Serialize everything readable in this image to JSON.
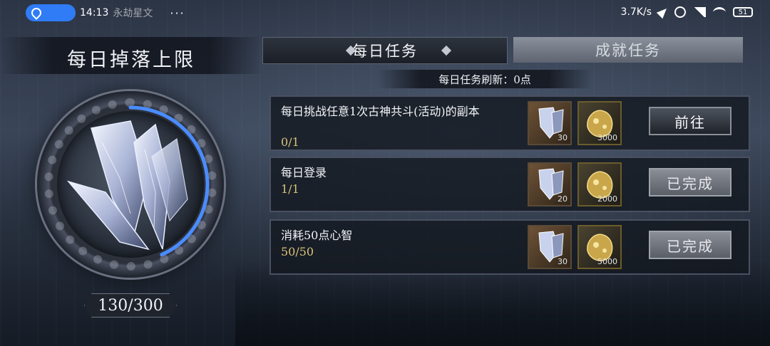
{
  "status_bar": {
    "time": "14:13",
    "app_ghost_text": "永劫星文",
    "dots": "···",
    "net_speed": "3.7K/s",
    "battery": "51"
  },
  "left_panel": {
    "title": "每日掉落上限",
    "counter": "130/300",
    "progress": {
      "current": 130,
      "max": 300
    }
  },
  "tabs": [
    {
      "label": "每日任务",
      "active": true
    },
    {
      "label": "成就任务",
      "active": false
    }
  ],
  "refresh_text": "每日任务刷新：0点",
  "tasks": [
    {
      "title": "每日挑战任意1次古神共斗(活动)的副本",
      "progress": "0/1",
      "rewards": [
        {
          "icon": "crystal-shard-icon",
          "count": "30"
        },
        {
          "icon": "gold-ore-icon",
          "count": "3000"
        }
      ],
      "button": "前往",
      "done": false
    },
    {
      "title": "每日登录",
      "progress": "1/1",
      "rewards": [
        {
          "icon": "crystal-shard-icon",
          "count": "20"
        },
        {
          "icon": "gold-ore-icon",
          "count": "2000"
        }
      ],
      "button": "已完成",
      "done": true
    },
    {
      "title": "消耗50点心智",
      "progress": "50/50",
      "rewards": [
        {
          "icon": "crystal-shard-icon",
          "count": "30"
        },
        {
          "icon": "gold-ore-icon",
          "count": "5000"
        }
      ],
      "button": "已完成",
      "done": true
    }
  ],
  "colors": {
    "progress_ring": "#4a8cff",
    "progress_text": "#d8c27a",
    "status_pill": "#2f7cf6"
  }
}
